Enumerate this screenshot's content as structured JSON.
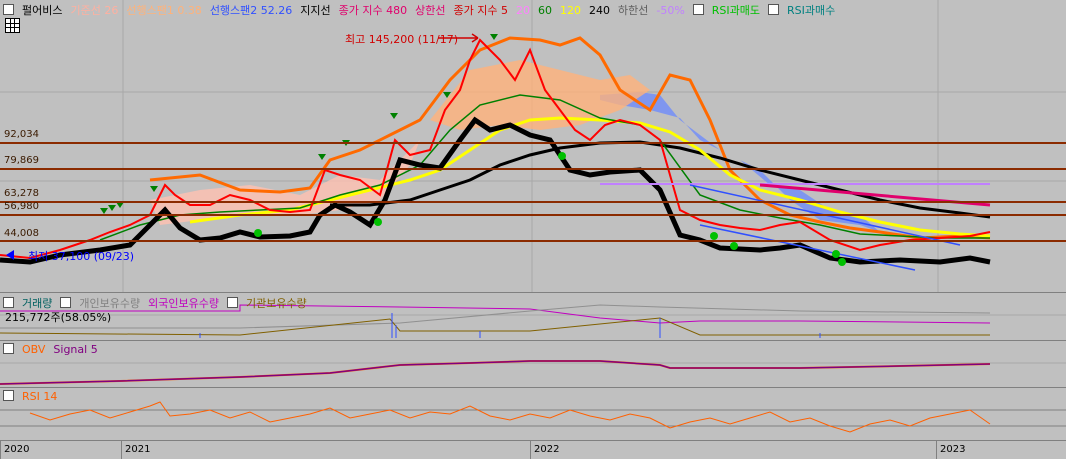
{
  "main": {
    "legend": [
      {
        "text": "펄어비스",
        "color": "#000000"
      },
      {
        "text": "기준선 26",
        "color": "#ffb0a0"
      },
      {
        "text": "선행스팬1 0.38",
        "color": "#ffb27a"
      },
      {
        "text": "선행스팬2 52.26",
        "color": "#3050ff"
      },
      {
        "text": "지지선",
        "color": "#000000"
      },
      {
        "text": "종가 지수 480",
        "color": "#e0006c"
      },
      {
        "text": "상한선",
        "color": "#e0006c"
      },
      {
        "text": "종가 지수 5",
        "color": "#d00000"
      },
      {
        "text": "20",
        "color": "#ff80ff"
      },
      {
        "text": "60",
        "color": "#008000"
      },
      {
        "text": "120",
        "color": "#ffff00"
      },
      {
        "text": "240",
        "color": "#000000"
      },
      {
        "text": "하한선",
        "color": "#606060"
      },
      {
        "text": "-50%",
        "color": "#c080ff"
      },
      {
        "text": "RSI과매도",
        "color": "#00c000"
      },
      {
        "text": "RSI과매수",
        "color": "#008080"
      }
    ],
    "price_levels": [
      {
        "label": "92,034",
        "value": 92034
      },
      {
        "label": "79,869",
        "value": 79869
      },
      {
        "label": "63,278",
        "value": 63278
      },
      {
        "label": "56,980",
        "value": 56980
      },
      {
        "label": "44,008",
        "value": 44008
      }
    ],
    "high_annotation": "최고 145,200 (11/17)",
    "low_annotation": "최저 37,100 (09/23)"
  },
  "volume": {
    "legend": [
      {
        "text": "거래량",
        "color": "#006060"
      },
      {
        "text": "개인보유수량",
        "color": "#808080"
      },
      {
        "text": "외국인보유수량",
        "color": "#c000c0"
      },
      {
        "text": "기관보유수량",
        "color": "#806000"
      }
    ],
    "value_label": "215,772주(58.05%)"
  },
  "obv": {
    "legend": [
      {
        "text": "OBV",
        "color": "#ff6000"
      },
      {
        "text": "Signal 5",
        "color": "#800080"
      }
    ]
  },
  "rsi": {
    "legend": [
      {
        "text": "RSI 14",
        "color": "#ff6000"
      }
    ]
  },
  "xaxis": {
    "labels": [
      "2020",
      "2021",
      "2022",
      "2023"
    ]
  },
  "colors": {
    "price_up": "#ff0000",
    "ma240": "#000000",
    "support": "#000000",
    "ma120": "#ffff00",
    "ma60": "#008000",
    "envelope": "#ff6a00",
    "ichimoku_cloud": "#6a88ff",
    "level_line": "#8b2b00"
  }
}
